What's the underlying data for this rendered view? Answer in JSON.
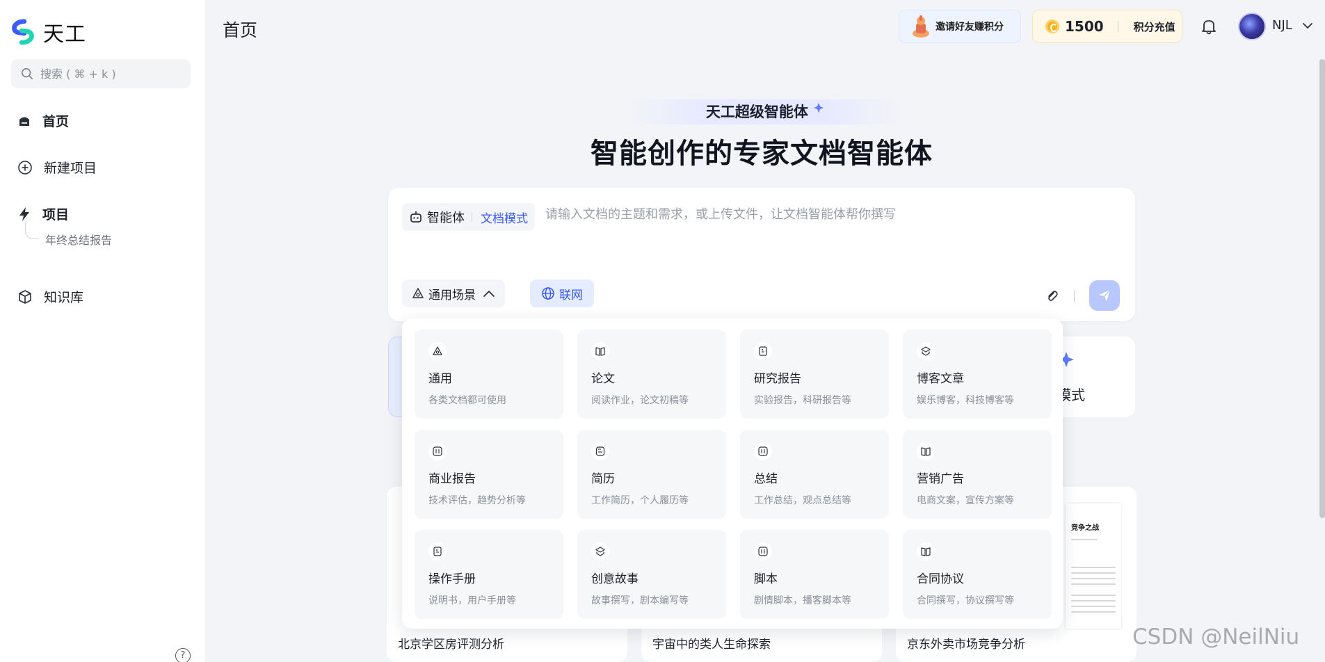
{
  "app": {
    "name": "天工"
  },
  "search": {
    "placeholder": "搜索 ( ⌘ + k )"
  },
  "nav": {
    "home": "首页",
    "new_project": "新建项目",
    "projects": "项目",
    "project_child": "年终总结报告",
    "knowledge": "知识库"
  },
  "header": {
    "title": "首页",
    "invite": "邀请好友赚积分",
    "points": "1500",
    "recharge": "积分充值",
    "username": "NJL"
  },
  "hero": {
    "badge": "天工超级智能体",
    "title": "智能创作的专家文档智能体"
  },
  "composer": {
    "agent_label": "智能体",
    "mode_label": "文档模式",
    "placeholder": "请输入文档的主题和需求，或上传文件，让文档智能体帮你撰写",
    "scene_label": "通用场景",
    "web_label": "联网"
  },
  "categories": [
    {
      "title": "通用",
      "desc": "各类文档都可使用",
      "icon": "triangle-icon"
    },
    {
      "title": "论文",
      "desc": "阅读作业，论文初稿等",
      "icon": "book-icon"
    },
    {
      "title": "研究报告",
      "desc": "实验报告，科研报告等",
      "icon": "doc-icon"
    },
    {
      "title": "博客文章",
      "desc": "娱乐博客，科技博客等",
      "icon": "layers-icon"
    },
    {
      "title": "商业报告",
      "desc": "技术评估，趋势分析等",
      "icon": "grid-icon"
    },
    {
      "title": "简历",
      "desc": "工作简历，个人履历等",
      "icon": "resume-icon"
    },
    {
      "title": "总结",
      "desc": "工作总结，观点总结等",
      "icon": "grid-icon"
    },
    {
      "title": "营销广告",
      "desc": "电商文案，宣传方案等",
      "icon": "book-icon"
    },
    {
      "title": "操作手册",
      "desc": "说明书，用户手册等",
      "icon": "doc-icon"
    },
    {
      "title": "创意故事",
      "desc": "故事撰写，剧本编写等",
      "icon": "layers-icon"
    },
    {
      "title": "脚本",
      "desc": "剧情脚本，播客脚本等",
      "icon": "grid-icon"
    },
    {
      "title": "合同协议",
      "desc": "合同撰写，协议撰写等",
      "icon": "book-icon"
    }
  ],
  "background": {
    "mode_card_label": "模式",
    "previews": [
      "北京学区房评测分析",
      "宇宙中的类人生命探索",
      "京东外卖市场竞争分析"
    ],
    "doc_thumb_title": "竞争之战"
  },
  "watermark": "CSDN @NeilNiu",
  "colors": {
    "accent": "#3858f5",
    "send_button": "#b8c8ff",
    "background": "#f3f4f7"
  }
}
